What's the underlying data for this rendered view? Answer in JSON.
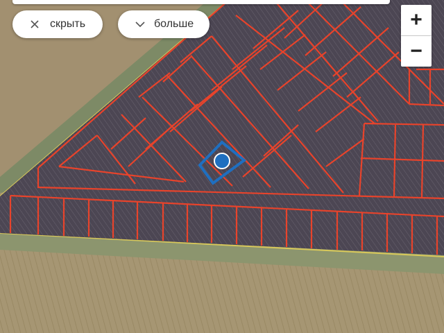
{
  "controls": {
    "hide_label": "скрыть",
    "more_label": "больше",
    "zoom_in_label": "+",
    "zoom_out_label": "−",
    "hide_icon": "close-icon",
    "more_icon": "chevron-down-icon"
  },
  "map": {
    "type": "satellite-cadastral",
    "parcel_border_color": "#e8432b",
    "selected_parcel_color": "#1f6fc0",
    "marker_color": "#1f6fc0",
    "field_color": "#a39470",
    "plot_area_color": "#4a4550",
    "road_edge_color": "#d8c85a"
  }
}
